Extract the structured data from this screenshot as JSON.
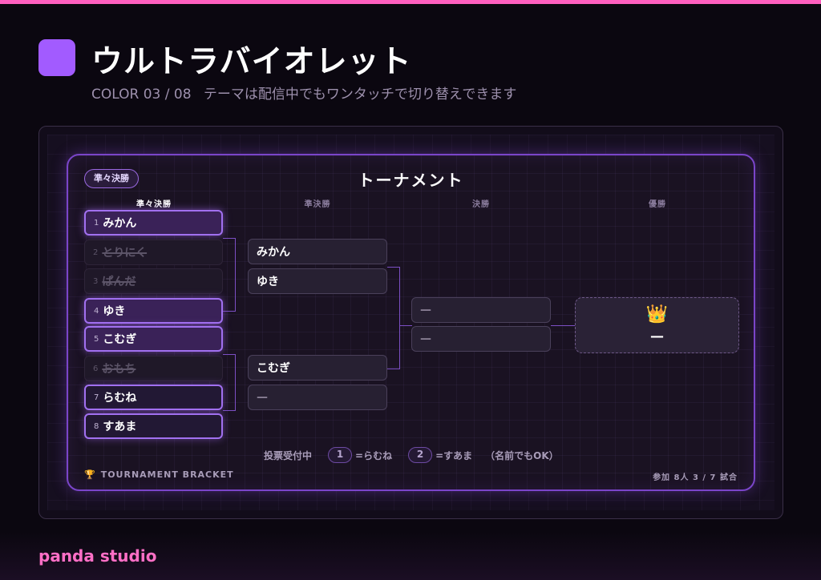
{
  "header": {
    "title": "ウルトラバイオレット",
    "color_index": "COLOR 03 / 08",
    "description": "テーマは配信中でもワンタッチで切り替えできます",
    "swatch_color": "#a25bff"
  },
  "bracket": {
    "round_badge": "準々決勝",
    "title": "トーナメント",
    "columns": [
      "準々決勝",
      "準決勝",
      "決勝",
      "優勝"
    ],
    "quarterfinals": [
      {
        "seed": "1",
        "name": "みかん",
        "state": "win"
      },
      {
        "seed": "2",
        "name": "とりにく",
        "state": "lose"
      },
      {
        "seed": "3",
        "name": "ぱんだ",
        "state": "lose"
      },
      {
        "seed": "4",
        "name": "ゆき",
        "state": "win"
      },
      {
        "seed": "5",
        "name": "こむぎ",
        "state": "win"
      },
      {
        "seed": "6",
        "name": "おもち",
        "state": "lose"
      },
      {
        "seed": "7",
        "name": "らむね",
        "state": "active"
      },
      {
        "seed": "8",
        "name": "すあま",
        "state": "active"
      }
    ],
    "semifinals": [
      "みかん",
      "ゆき",
      "こむぎ",
      "—"
    ],
    "final": [
      "—",
      "—"
    ],
    "champion": {
      "icon": "👑",
      "name": "—"
    },
    "vote": {
      "label": "投票受付中",
      "option1_key": "1",
      "option1_text": "=らむね",
      "option2_key": "2",
      "option2_text": "=すあま",
      "note": "（名前でもOK）"
    },
    "footer_left": "TOURNAMENT BRACKET",
    "footer_right": "参加 8人 3 / 7 試合"
  },
  "brand": "panda studio",
  "colors": {
    "accent": "#a170f0",
    "brand": "#ff6fc6",
    "top_strip": "#ff5fbf"
  }
}
